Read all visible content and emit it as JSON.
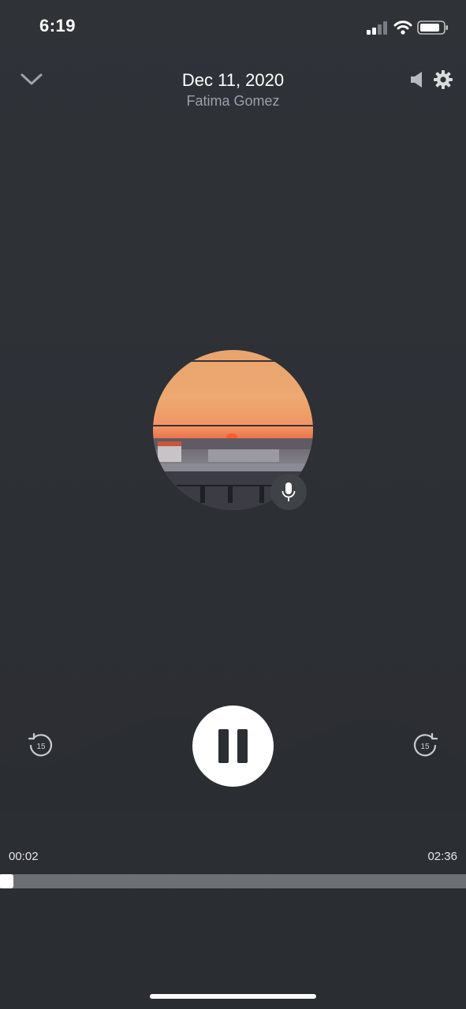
{
  "status_bar": {
    "time": "6:19",
    "icons": [
      "signal-icon",
      "wifi-icon",
      "battery-icon"
    ]
  },
  "header": {
    "title": "Dec 11, 2020",
    "subtitle": "Fatima Gomez",
    "icons": [
      "chevron-down-icon",
      "speaker-icon",
      "gear-icon"
    ]
  },
  "artwork": {
    "badge_icon": "microphone-icon"
  },
  "controls": {
    "rewind_label": "15",
    "forward_label": "15",
    "play_state": "playing",
    "icons": [
      "rewind-15-icon",
      "pause-icon",
      "forward-15-icon"
    ]
  },
  "progress": {
    "elapsed": "00:02",
    "total": "02:36",
    "fraction": 0.013
  },
  "colors": {
    "background": "#2c2f34",
    "text_secondary": "#9aa0a8",
    "track": "#6c6f74",
    "accent": "#ffffff"
  }
}
